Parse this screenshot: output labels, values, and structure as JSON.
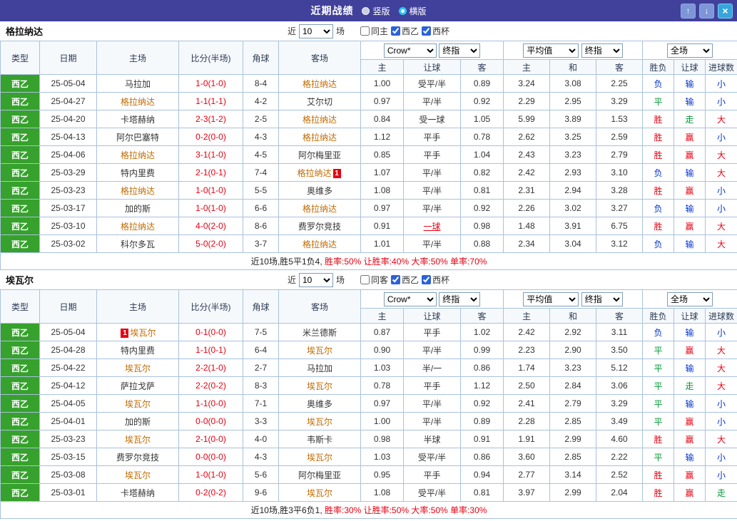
{
  "topbar": {
    "title": "近期战绩",
    "radio_vertical": "竖版",
    "radio_horizontal": "横版",
    "icons": {
      "up": "↑",
      "down": "↓",
      "close": "×"
    }
  },
  "colors": {
    "accent_bar": "#41419b",
    "btn_blue": "#7d96d8",
    "btn_close": "#36a6dc",
    "radio_selected": "#2cc8f0",
    "type_green": "#36a12c",
    "self_team": "#c26a00",
    "score_red": "#e60012",
    "grid": "#a9c2dd"
  },
  "result_colors": {
    "胜": "#e60012",
    "赢": "#e60012",
    "大": "#e60012",
    "平": "#009933",
    "走": "#009933",
    "负": "#0033cc",
    "输": "#0033cc",
    "小": "#0033cc"
  },
  "table": {
    "filter": {
      "near_label": "近",
      "games_label": "场"
    },
    "columns": [
      "类型",
      "日期",
      "主场",
      "比分(半场)",
      "角球",
      "客场"
    ],
    "odds_group1": {
      "book": "Crow*",
      "stage": "终指",
      "cols": [
        "主",
        "让球",
        "客"
      ]
    },
    "odds_group2": {
      "book": "平均值",
      "stage": "终指",
      "cols": [
        "主",
        "和",
        "客"
      ]
    },
    "result_group": {
      "scope": "全场",
      "cols": [
        "胜负",
        "让球",
        "进球数"
      ]
    }
  },
  "sections": [
    {
      "team": "格拉纳达",
      "recent_count": "10",
      "checkboxes": [
        {
          "label": "同主",
          "checked": false
        },
        {
          "label": "西乙",
          "checked": true
        },
        {
          "label": "西杯",
          "checked": true
        }
      ],
      "rows": [
        {
          "type": "西乙",
          "date": "25-05-04",
          "home": "马拉加",
          "away": "格拉纳达",
          "self": "away",
          "score": "1-0(1-0)",
          "corners": "8-4",
          "asia": [
            "1.00",
            "受平/半",
            "0.89"
          ],
          "euro": [
            "3.24",
            "3.08",
            "2.25"
          ],
          "results": [
            "负",
            "输",
            "小"
          ]
        },
        {
          "type": "西乙",
          "date": "25-04-27",
          "home": "格拉纳达",
          "away": "艾尔切",
          "self": "home",
          "score": "1-1(1-1)",
          "corners": "4-2",
          "asia": [
            "0.97",
            "平/半",
            "0.92"
          ],
          "euro": [
            "2.29",
            "2.95",
            "3.29"
          ],
          "results": [
            "平",
            "输",
            "小"
          ]
        },
        {
          "type": "西乙",
          "date": "25-04-20",
          "home": "卡塔赫纳",
          "away": "格拉纳达",
          "self": "away",
          "score": "2-3(1-2)",
          "corners": "2-5",
          "asia": [
            "0.84",
            "受一球",
            "1.05"
          ],
          "euro": [
            "5.99",
            "3.89",
            "1.53"
          ],
          "results": [
            "胜",
            "走",
            "大"
          ]
        },
        {
          "type": "西乙",
          "date": "25-04-13",
          "home": "阿尔巴塞特",
          "away": "格拉纳达",
          "self": "away",
          "score": "0-2(0-0)",
          "corners": "4-3",
          "asia": [
            "1.12",
            "平手",
            "0.78"
          ],
          "euro": [
            "2.62",
            "3.25",
            "2.59"
          ],
          "results": [
            "胜",
            "赢",
            "小"
          ]
        },
        {
          "type": "西乙",
          "date": "25-04-06",
          "home": "格拉纳达",
          "away": "阿尔梅里亚",
          "self": "home",
          "score": "3-1(1-0)",
          "corners": "4-5",
          "asia": [
            "0.85",
            "平手",
            "1.04"
          ],
          "euro": [
            "2.43",
            "3.23",
            "2.79"
          ],
          "results": [
            "胜",
            "赢",
            "大"
          ]
        },
        {
          "type": "西乙",
          "date": "25-03-29",
          "home": "特内里费",
          "away": "格拉纳达",
          "self": "away",
          "away_badge": {
            "text": "1",
            "pos": "after"
          },
          "score": "2-1(0-1)",
          "corners": "7-4",
          "asia": [
            "1.07",
            "平/半",
            "0.82"
          ],
          "euro": [
            "2.42",
            "2.93",
            "3.10"
          ],
          "results": [
            "负",
            "输",
            "大"
          ]
        },
        {
          "type": "西乙",
          "date": "25-03-23",
          "home": "格拉纳达",
          "away": "奥维多",
          "self": "home",
          "score": "1-0(1-0)",
          "corners": "5-5",
          "asia": [
            "1.08",
            "平/半",
            "0.81"
          ],
          "euro": [
            "2.31",
            "2.94",
            "3.28"
          ],
          "results": [
            "胜",
            "赢",
            "小"
          ]
        },
        {
          "type": "西乙",
          "date": "25-03-17",
          "home": "加的斯",
          "away": "格拉纳达",
          "self": "away",
          "score": "1-0(1-0)",
          "corners": "6-6",
          "asia": [
            "0.97",
            "平/半",
            "0.92"
          ],
          "euro": [
            "2.26",
            "3.02",
            "3.27"
          ],
          "results": [
            "负",
            "输",
            "小"
          ]
        },
        {
          "type": "西乙",
          "date": "25-03-10",
          "home": "格拉纳达",
          "away": "费罗尔竞技",
          "self": "home",
          "score": "4-0(2-0)",
          "corners": "8-6",
          "asia": [
            "0.91",
            "一球",
            "0.98"
          ],
          "handicap_alert": true,
          "euro": [
            "1.48",
            "3.91",
            "6.75"
          ],
          "results": [
            "胜",
            "赢",
            "大"
          ]
        },
        {
          "type": "西乙",
          "date": "25-03-02",
          "home": "科尔多瓦",
          "away": "格拉纳达",
          "self": "away",
          "score": "5-0(2-0)",
          "corners": "3-7",
          "asia": [
            "1.01",
            "平/半",
            "0.88"
          ],
          "euro": [
            "2.34",
            "3.04",
            "3.12"
          ],
          "results": [
            "负",
            "输",
            "大"
          ]
        }
      ],
      "summary": {
        "prefix": "近10场,胜5平1负4, ",
        "rates": "胜率:50% 让胜率:40% 大率:50% 单率:70%"
      }
    },
    {
      "team": "埃瓦尔",
      "recent_count": "10",
      "checkboxes": [
        {
          "label": "同客",
          "checked": false
        },
        {
          "label": "西乙",
          "checked": true
        },
        {
          "label": "西杯",
          "checked": true
        }
      ],
      "rows": [
        {
          "type": "西乙",
          "date": "25-05-04",
          "home": "埃瓦尔",
          "away": "米兰德斯",
          "self": "home",
          "home_badge": {
            "text": "1",
            "pos": "before"
          },
          "score": "0-1(0-0)",
          "corners": "7-5",
          "asia": [
            "0.87",
            "平手",
            "1.02"
          ],
          "euro": [
            "2.42",
            "2.92",
            "3.11"
          ],
          "results": [
            "负",
            "输",
            "小"
          ]
        },
        {
          "type": "西乙",
          "date": "25-04-28",
          "home": "特内里费",
          "away": "埃瓦尔",
          "self": "away",
          "score": "1-1(0-1)",
          "corners": "6-4",
          "asia": [
            "0.90",
            "平/半",
            "0.99"
          ],
          "euro": [
            "2.23",
            "2.90",
            "3.50"
          ],
          "results": [
            "平",
            "赢",
            "大"
          ]
        },
        {
          "type": "西乙",
          "date": "25-04-22",
          "home": "埃瓦尔",
          "away": "马拉加",
          "self": "home",
          "score": "2-2(1-0)",
          "corners": "2-7",
          "asia": [
            "1.03",
            "半/一",
            "0.86"
          ],
          "euro": [
            "1.74",
            "3.23",
            "5.12"
          ],
          "results": [
            "平",
            "输",
            "大"
          ]
        },
        {
          "type": "西乙",
          "date": "25-04-12",
          "home": "萨拉戈萨",
          "away": "埃瓦尔",
          "self": "away",
          "score": "2-2(0-2)",
          "corners": "8-3",
          "asia": [
            "0.78",
            "平手",
            "1.12"
          ],
          "euro": [
            "2.50",
            "2.84",
            "3.06"
          ],
          "results": [
            "平",
            "走",
            "大"
          ]
        },
        {
          "type": "西乙",
          "date": "25-04-05",
          "home": "埃瓦尔",
          "away": "奥维多",
          "self": "home",
          "score": "1-1(0-0)",
          "corners": "7-1",
          "asia": [
            "0.97",
            "平/半",
            "0.92"
          ],
          "euro": [
            "2.41",
            "2.79",
            "3.29"
          ],
          "results": [
            "平",
            "输",
            "小"
          ]
        },
        {
          "type": "西乙",
          "date": "25-04-01",
          "home": "加的斯",
          "away": "埃瓦尔",
          "self": "away",
          "score": "0-0(0-0)",
          "corners": "3-3",
          "asia": [
            "1.00",
            "平/半",
            "0.89"
          ],
          "euro": [
            "2.28",
            "2.85",
            "3.49"
          ],
          "results": [
            "平",
            "赢",
            "小"
          ]
        },
        {
          "type": "西乙",
          "date": "25-03-23",
          "home": "埃瓦尔",
          "away": "韦斯卡",
          "self": "home",
          "score": "2-1(0-0)",
          "corners": "4-0",
          "asia": [
            "0.98",
            "半球",
            "0.91"
          ],
          "euro": [
            "1.91",
            "2.99",
            "4.60"
          ],
          "results": [
            "胜",
            "赢",
            "大"
          ]
        },
        {
          "type": "西乙",
          "date": "25-03-15",
          "home": "费罗尔竞技",
          "away": "埃瓦尔",
          "self": "away",
          "score": "0-0(0-0)",
          "corners": "4-3",
          "asia": [
            "1.03",
            "受平/半",
            "0.86"
          ],
          "euro": [
            "3.60",
            "2.85",
            "2.22"
          ],
          "results": [
            "平",
            "输",
            "小"
          ]
        },
        {
          "type": "西乙",
          "date": "25-03-08",
          "home": "埃瓦尔",
          "away": "阿尔梅里亚",
          "self": "home",
          "score": "1-0(1-0)",
          "corners": "5-6",
          "asia": [
            "0.95",
            "平手",
            "0.94"
          ],
          "euro": [
            "2.77",
            "3.14",
            "2.52"
          ],
          "results": [
            "胜",
            "赢",
            "小"
          ]
        },
        {
          "type": "西乙",
          "date": "25-03-01",
          "home": "卡塔赫纳",
          "away": "埃瓦尔",
          "self": "away",
          "score": "0-2(0-2)",
          "corners": "9-6",
          "asia": [
            "1.08",
            "受平/半",
            "0.81"
          ],
          "euro": [
            "3.97",
            "2.99",
            "2.04"
          ],
          "results": [
            "胜",
            "赢",
            "走"
          ]
        }
      ],
      "summary": {
        "prefix": "近10场,胜3平6负1, ",
        "rates": "胜率:30% 让胜率:50% 大率:50% 单率:30%"
      }
    }
  ]
}
